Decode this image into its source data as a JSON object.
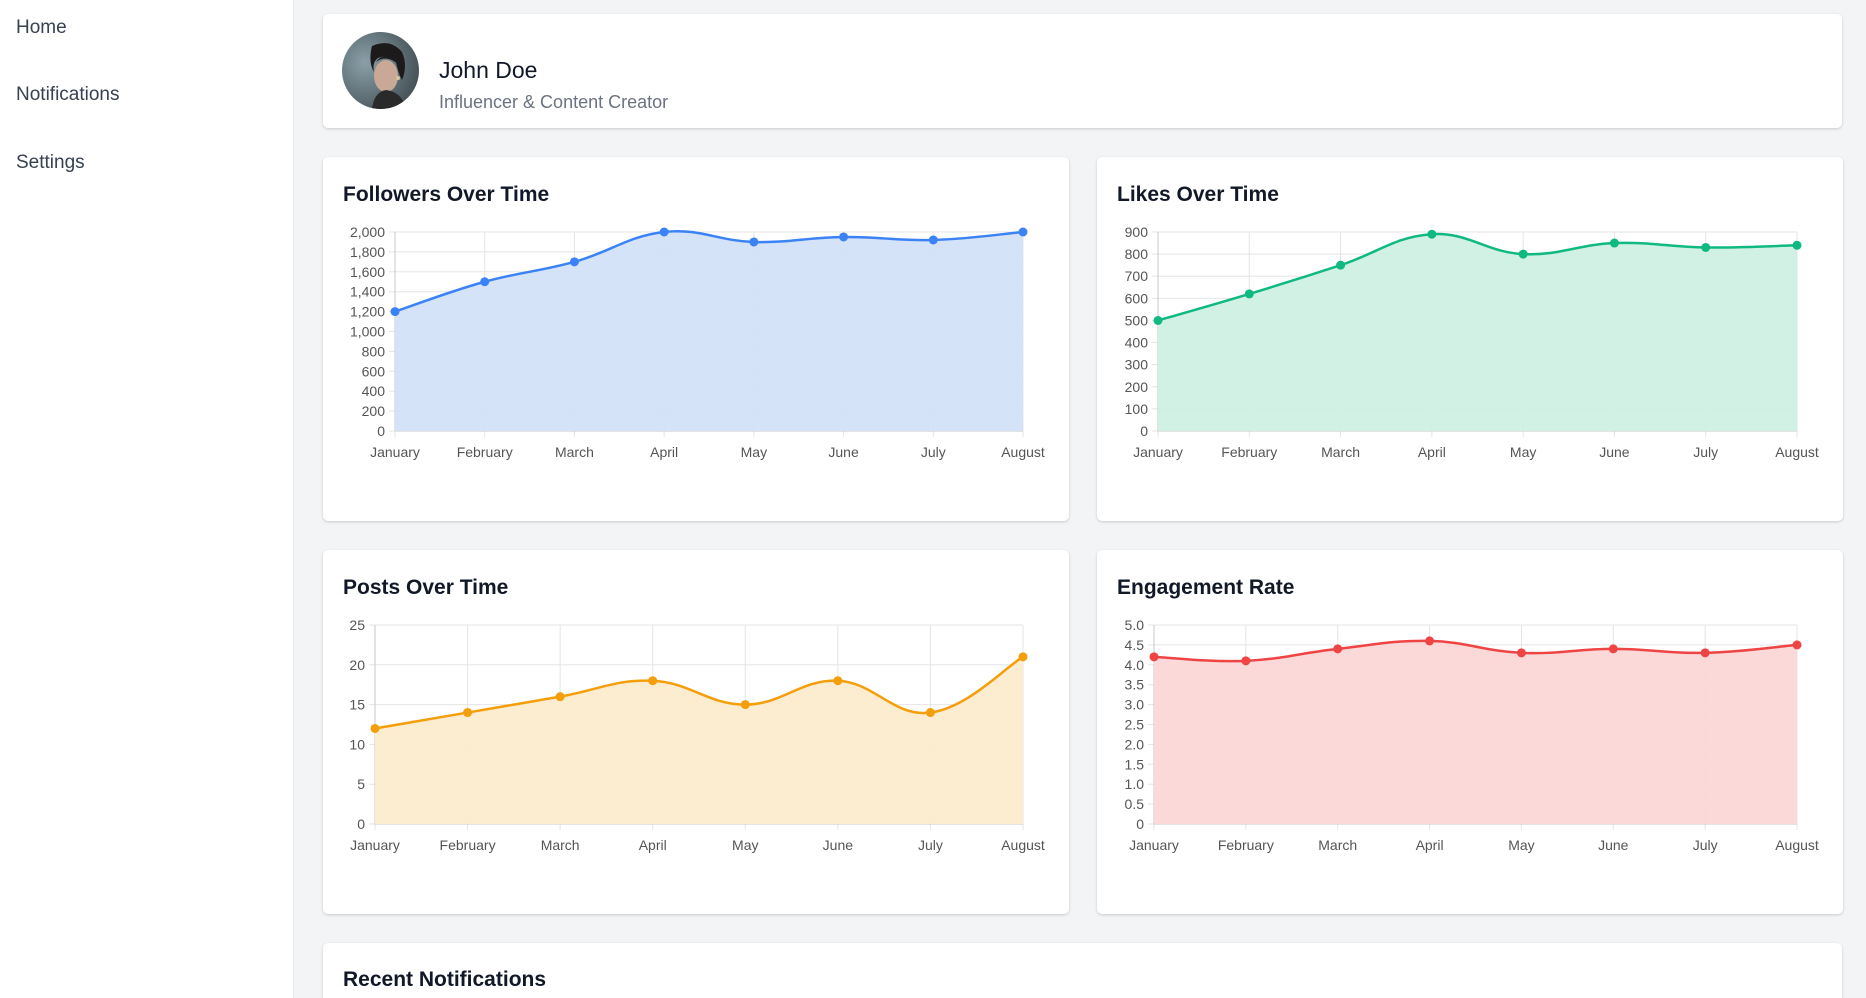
{
  "sidebar": {
    "items": [
      {
        "label": "Home"
      },
      {
        "label": "Notifications"
      },
      {
        "label": "Settings"
      }
    ]
  },
  "profile": {
    "name": "John Doe",
    "subtitle": "Influencer & Content Creator"
  },
  "notifications": {
    "title": "Recent Notifications"
  },
  "chart_data": [
    {
      "type": "area",
      "title": "Followers Over Time",
      "categories": [
        "January",
        "February",
        "March",
        "April",
        "May",
        "June",
        "July",
        "August"
      ],
      "series": [
        {
          "values": [
            1200,
            1500,
            1700,
            2000,
            1900,
            1950,
            1920,
            2000
          ]
        }
      ],
      "ylim": [
        0,
        2000
      ],
      "yticks": [
        0,
        200,
        400,
        600,
        800,
        1000,
        1200,
        1400,
        1600,
        1800,
        2000
      ],
      "yticklabels": [
        "0",
        "200",
        "400",
        "600",
        "800",
        "1,000",
        "1,200",
        "1,400",
        "1,600",
        "1,800",
        "2,000"
      ],
      "color": "#3b82f6",
      "fill": "#d3e1f9",
      "grid": true
    },
    {
      "type": "area",
      "title": "Likes Over Time",
      "categories": [
        "January",
        "February",
        "March",
        "April",
        "May",
        "June",
        "July",
        "August"
      ],
      "series": [
        {
          "values": [
            500,
            620,
            750,
            890,
            800,
            850,
            830,
            840
          ]
        }
      ],
      "ylim": [
        0,
        900
      ],
      "yticks": [
        0,
        100,
        200,
        300,
        400,
        500,
        600,
        700,
        800,
        900
      ],
      "yticklabels": [
        "0",
        "100",
        "200",
        "300",
        "400",
        "500",
        "600",
        "700",
        "800",
        "900"
      ],
      "color": "#10b981",
      "fill": "#cff0e3",
      "grid": true
    },
    {
      "type": "area",
      "title": "Posts Over Time",
      "categories": [
        "January",
        "February",
        "March",
        "April",
        "May",
        "June",
        "July",
        "August"
      ],
      "series": [
        {
          "values": [
            12,
            14,
            16,
            18,
            15,
            18,
            14,
            21
          ]
        }
      ],
      "ylim": [
        0,
        25
      ],
      "yticks": [
        0,
        5,
        10,
        15,
        20,
        25
      ],
      "yticklabels": [
        "0",
        "5",
        "10",
        "15",
        "20",
        "25"
      ],
      "color": "#f59e0b",
      "fill": "#fdeccd",
      "grid": true
    },
    {
      "type": "area",
      "title": "Engagement Rate",
      "categories": [
        "January",
        "February",
        "March",
        "April",
        "May",
        "June",
        "July",
        "August"
      ],
      "series": [
        {
          "values": [
            4.2,
            4.1,
            4.4,
            4.6,
            4.3,
            4.4,
            4.3,
            4.5
          ]
        }
      ],
      "ylim": [
        0,
        5
      ],
      "yticks": [
        0,
        0.5,
        1,
        1.5,
        2,
        2.5,
        3,
        3.5,
        4,
        4.5,
        5
      ],
      "yticklabels": [
        "0",
        "0.5",
        "1.0",
        "1.5",
        "2.0",
        "2.5",
        "3.0",
        "3.5",
        "4.0",
        "4.5",
        "5.0"
      ],
      "color": "#ef4444",
      "fill": "#fbd7d7",
      "grid": true
    }
  ]
}
